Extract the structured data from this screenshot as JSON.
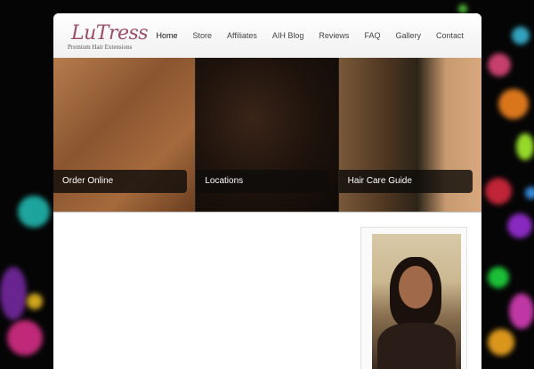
{
  "logo": {
    "name": "LuTress",
    "tagline": "Premium Hair Extensions"
  },
  "nav": {
    "items": [
      {
        "label": "Home",
        "active": true
      },
      {
        "label": "Store"
      },
      {
        "label": "Affiliates"
      },
      {
        "label": "AIH Blog"
      },
      {
        "label": "Reviews"
      },
      {
        "label": "FAQ"
      },
      {
        "label": "Gallery"
      },
      {
        "label": "Contact"
      }
    ]
  },
  "hero": {
    "panels": [
      {
        "label": "Order Online"
      },
      {
        "label": "Locations"
      },
      {
        "label": "Hair Care Guide"
      }
    ]
  },
  "colors": {
    "logo_accent": "#9b4d6a",
    "page_background": "#050505"
  }
}
